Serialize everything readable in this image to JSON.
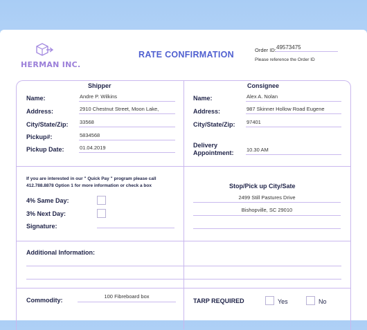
{
  "company": {
    "name": "HERMAN INC."
  },
  "document": {
    "title": "RATE CONFIRMATION"
  },
  "order": {
    "label": "Order ID:",
    "value": "49573475",
    "note": "Please reference the Order ID"
  },
  "shipper": {
    "title": "Shipper",
    "name_label": "Name:",
    "name": "Andre P. Wilkins",
    "address_label": "Address:",
    "address": "2910 Chestnut Street, Moon Lake,",
    "csz_label": "City/State/Zip:",
    "csz": "33568",
    "pickup_label": "Pickup#:",
    "pickup": "5834568",
    "date_label": "Pickup Date:",
    "date": "01.04.2019"
  },
  "consignee": {
    "title": "Consignee",
    "name_label": "Name:",
    "name": "Alex A. Nolan",
    "address_label": "Address:",
    "address": "987 Skinner Hollow Road Eugene",
    "csz_label": "City/State/Zip:",
    "csz": "97401",
    "appt_label_1": "Delivery",
    "appt_label_2": "Appointment:",
    "appt": "10.30 AM"
  },
  "quickpay": {
    "text": "If you are interested in our \" Quick Pay \" program please call 412.788.8878 Option 1 for more information or check a box",
    "same_day_label": "4% Same Day:",
    "next_day_label": "3% Next Day:",
    "signature_label": "Signature:"
  },
  "stop": {
    "title": "Stop/Pick up City/Sate",
    "line1": "2499 Still Pastures Drive",
    "line2": "Bishopville, SC 29010"
  },
  "additional": {
    "label": "Additional Information:"
  },
  "commodity": {
    "label": "Commodity:",
    "value": "100 Fibreboard box"
  },
  "tarp": {
    "label": "TARP REQUIRED",
    "yes_label": "Yes",
    "no_label": "No"
  },
  "colors": {
    "accent": "#4f5fd0",
    "logo": "#9b7fd9",
    "border": "#c9b7ee"
  }
}
